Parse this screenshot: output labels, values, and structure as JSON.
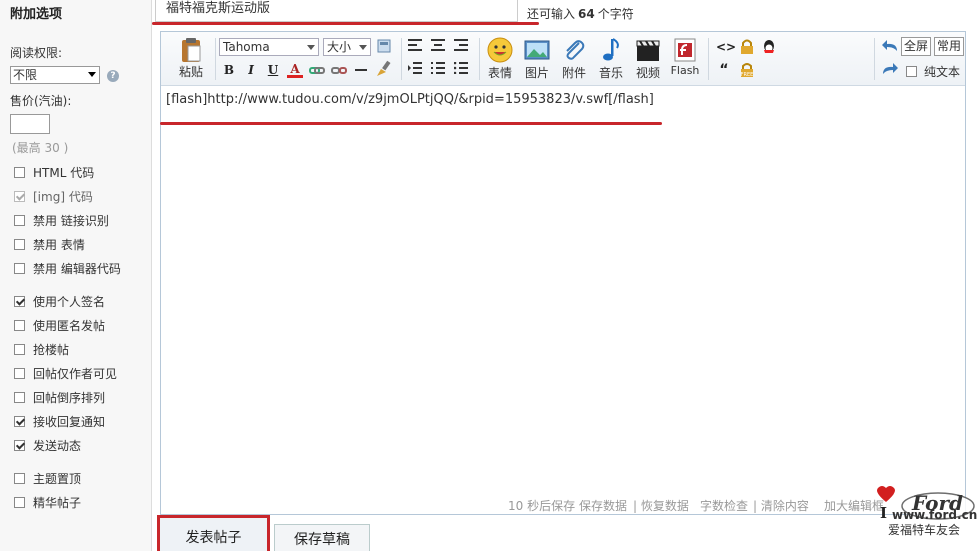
{
  "sidebar": {
    "title": "附加选项",
    "read_perm_label": "阅读权限:",
    "read_perm_value": "不限",
    "price_label": "售价(汽油):",
    "price_value": "",
    "price_hint": "(最高 30 )",
    "options": [
      {
        "label": "HTML 代码",
        "checked": false,
        "disabled": false
      },
      {
        "label": "[img] 代码",
        "checked": true,
        "disabled": true
      },
      {
        "label": "禁用  链接识别",
        "checked": false,
        "disabled": false
      },
      {
        "label": "禁用  表情",
        "checked": false,
        "disabled": false
      },
      {
        "label": "禁用  编辑器代码",
        "checked": false,
        "disabled": false
      },
      {
        "label": "使用个人签名",
        "checked": true,
        "disabled": false
      },
      {
        "label": "使用匿名发帖",
        "checked": false,
        "disabled": false
      },
      {
        "label": "抢楼帖",
        "checked": false,
        "disabled": false
      },
      {
        "label": "回帖仅作者可见",
        "checked": false,
        "disabled": false
      },
      {
        "label": "回帖倒序排列",
        "checked": false,
        "disabled": false
      },
      {
        "label": "接收回复通知",
        "checked": true,
        "disabled": false
      },
      {
        "label": "发送动态",
        "checked": true,
        "disabled": false
      },
      {
        "label": "主题置顶",
        "checked": false,
        "disabled": false
      },
      {
        "label": "精华帖子",
        "checked": false,
        "disabled": false
      }
    ]
  },
  "post": {
    "title_value": "福特福克斯运动版",
    "char_hint_prefix": "还可输入",
    "char_hint_count": "64",
    "char_hint_suffix": "个字符"
  },
  "toolbar": {
    "paste": "粘贴",
    "font": "Tahoma",
    "size": "大小",
    "bold": "B",
    "italic": "I",
    "underline": "U",
    "font_color": "A",
    "emoticon": "表情",
    "image": "图片",
    "attachment": "附件",
    "music": "音乐",
    "video": "视频",
    "flash": "Flash",
    "fullscreen": "全屏",
    "common": "常用",
    "plain_text": "纯文本"
  },
  "editor": {
    "content": "[flash]http://www.tudou.com/v/z9jmOLPtjQQ/&rpid=15953823/v.swf[/flash]"
  },
  "statusbar": {
    "autosave": "10 秒后保存",
    "save_data": "保存数据",
    "restore_data": "| 恢复数据",
    "word_check": "字数检查",
    "clear": "| 清除内容",
    "enlarge": "加大编辑框"
  },
  "actions": {
    "submit": "发表帖子",
    "save_draft": "保存草稿"
  },
  "watermark": {
    "brand": "Ford",
    "site": "www.ford.cn",
    "community": "爱福特车友会",
    "i_letter": "I"
  },
  "colors": {
    "highlight_red": "#c8262b",
    "editor_border": "#b5c7d8"
  }
}
